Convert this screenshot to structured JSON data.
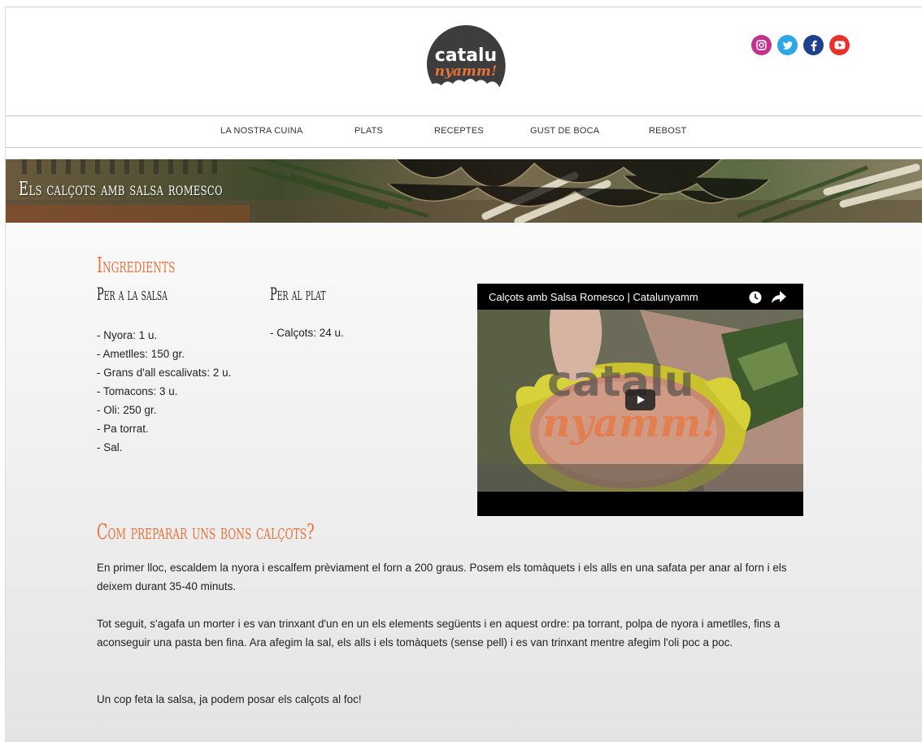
{
  "brand": {
    "logo_line1": "catalu",
    "logo_line2": "nyamm!",
    "colors": {
      "accent": "#e8743c",
      "logo_bg": "#3d3d3d"
    }
  },
  "socials": [
    {
      "name": "instagram-icon",
      "color": "#c2338b"
    },
    {
      "name": "twitter-icon",
      "color": "#2ea6e8"
    },
    {
      "name": "facebook-icon",
      "color": "#1d3f8c"
    },
    {
      "name": "youtube-icon",
      "color": "#e8312b"
    }
  ],
  "nav": {
    "items": [
      "LA NOSTRA CUINA",
      "PLATS",
      "RECEPTES",
      "GUST DE BOCA",
      "REBOST"
    ]
  },
  "banner": {
    "title": "Els calçots amb salsa romesco"
  },
  "ingredients": {
    "heading": "Ingredients",
    "sauce": {
      "heading": "Per a la salsa",
      "items": [
        "- Nyora: 1 u.",
        "- Ametlles: 150 gr.",
        "- Grans d'all escalivats: 2 u.",
        "- Tomacons: 3 u.",
        "- Oli: 250 gr.",
        "- Pa torrat.",
        "- Sal."
      ]
    },
    "dish": {
      "heading": "Per al plat",
      "items": [
        "- Calçots: 24 u."
      ]
    }
  },
  "video": {
    "title": "Calçots amb Salsa Romesco | Catalunyamm",
    "watermark_line1": "catalu",
    "watermark_line2": "nyamm!"
  },
  "preparation": {
    "heading": "Com preparar uns bons calçots?",
    "paragraphs": [
      "En primer lloc, escaldem la nyora i escalfem prèviament el forn a 200 graus. Posem els tomàquets i els alls en una safata per anar al forn i els deixem durant 35-40 minuts.",
      "Tot seguit, s'agafa un morter i es van trinxant d'un en un els elements següents i en aquest ordre: pa torrant, polpa de nyora i ametlles, fins a aconseguir una pasta ben fina. Ara afegim la sal, els alls i els tomàquets (sense pell) i es van trinxant mentre afegim l'oli poc a poc.",
      "Un cop feta la salsa, ja podem posar els calçots al foc!"
    ]
  }
}
